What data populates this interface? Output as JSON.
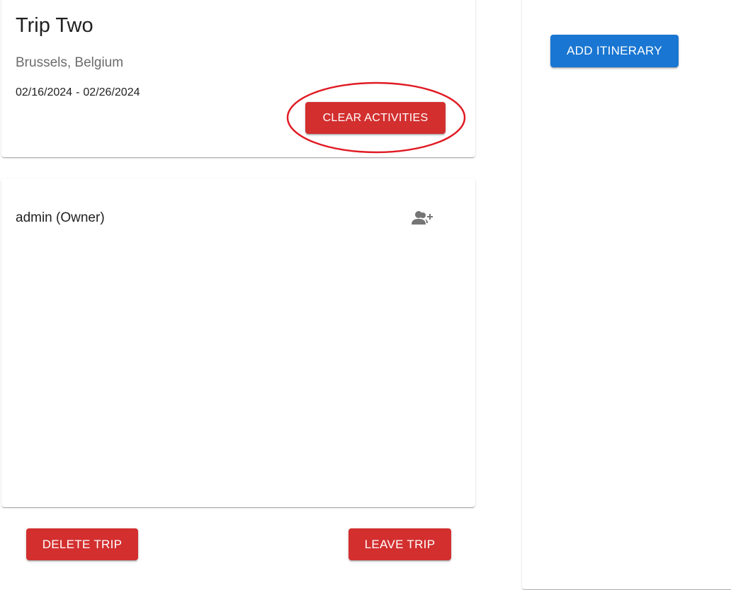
{
  "trip": {
    "title": "Trip Two",
    "location": "Brussels, Belgium",
    "start_date": "02/16/2024",
    "date_separator": "-",
    "end_date": "02/26/2024",
    "clear_activities_label": "CLEAR ACTIVITIES"
  },
  "highlight": {
    "color": "#e01b24"
  },
  "members": {
    "items": [
      {
        "label": "admin (Owner)"
      }
    ],
    "add_member_icon": "person-add-icon"
  },
  "actions": {
    "delete_trip_label": "DELETE TRIP",
    "leave_trip_label": "LEAVE TRIP"
  },
  "itinerary": {
    "add_itinerary_label": "ADD ITINERARY"
  },
  "colors": {
    "danger": "#d32f2f",
    "primary": "#1976d2",
    "icon": "#757575"
  }
}
